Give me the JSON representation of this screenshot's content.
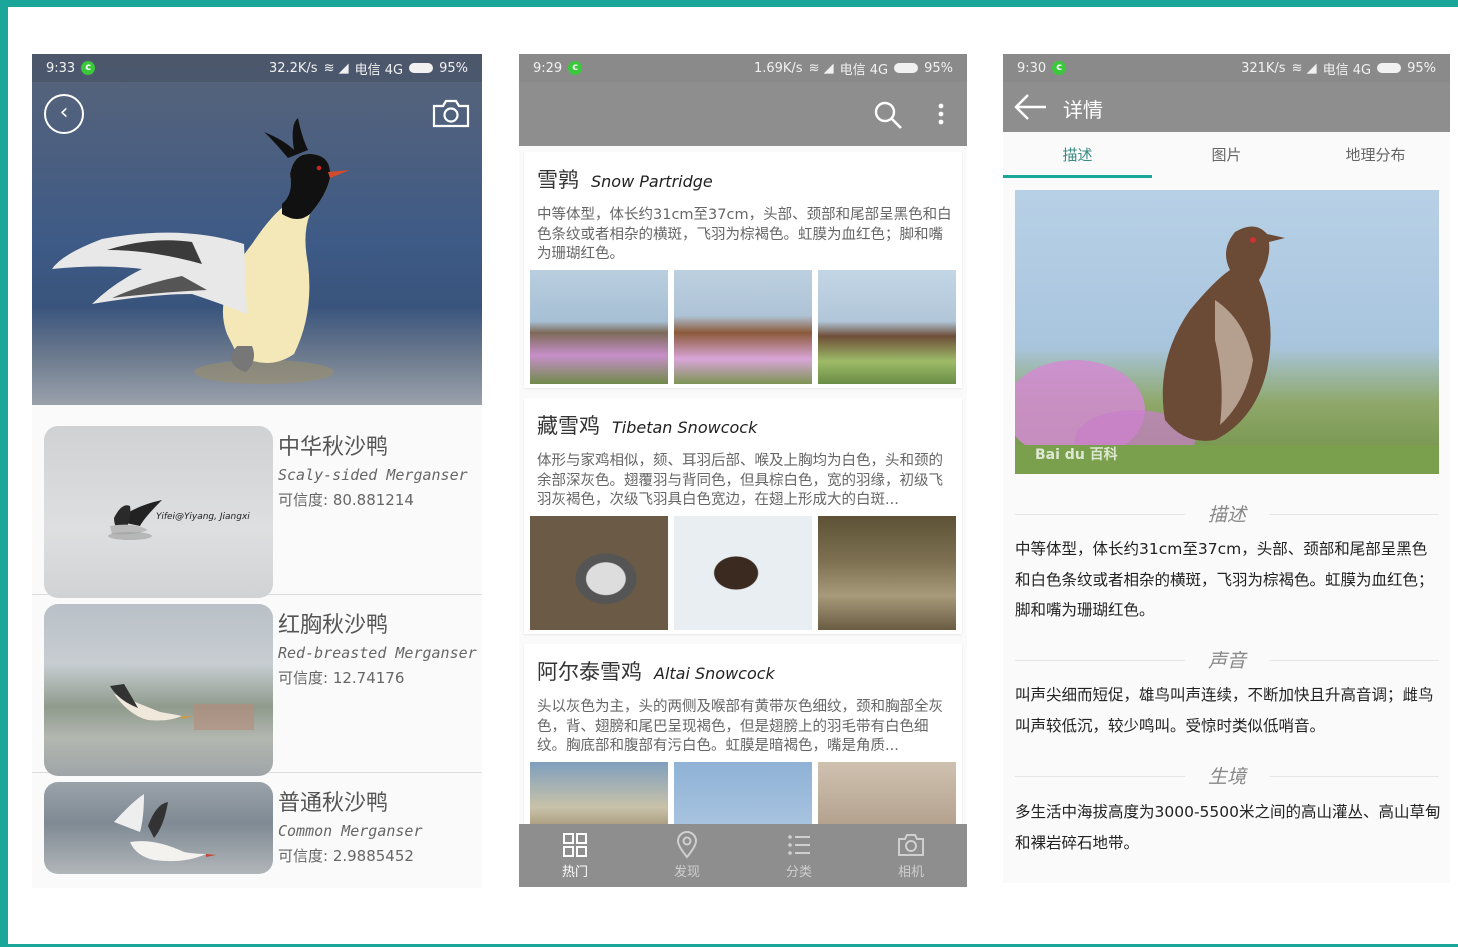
{
  "screens": {
    "identify": {
      "status": {
        "time": "9:33",
        "speed": "32.2K/s",
        "carrier": "电信 4G",
        "battery": "95%"
      },
      "photo_watermark": "Yifei@Yiyang, Jiangxi",
      "results": [
        {
          "cn": "中华秋沙鸭",
          "en": "Scaly-sided Merganser",
          "confidence": "可信度: 80.881214"
        },
        {
          "cn": "红胸秋沙鸭",
          "en": "Red-breasted Merganser",
          "confidence": "可信度: 12.74176"
        },
        {
          "cn": "普通秋沙鸭",
          "en": "Common Merganser",
          "confidence": "可信度: 2.9885452"
        }
      ]
    },
    "browse": {
      "status": {
        "time": "9:29",
        "speed": "1.69K/s",
        "carrier": "电信 4G",
        "battery": "95%"
      },
      "cards": [
        {
          "cn": "雪鹑",
          "en": "Snow Partridge",
          "desc": "中等体型，体长约31cm至37cm，头部、颈部和尾部呈黑色和白色条纹或者相杂的横斑，飞羽为棕褐色。虹膜为血红色；脚和嘴为珊瑚红色。"
        },
        {
          "cn": "藏雪鸡",
          "en": "Tibetan Snowcock",
          "desc": "体形与家鸡相似，颏、耳羽后部、喉及上胸均为白色，头和颈的余部深灰色。翅覆羽与背同色，但具棕白色，宽的羽缘，初级飞羽灰褐色，次级飞羽具白色宽边，在翅上形成大的白斑..."
        },
        {
          "cn": "阿尔泰雪鸡",
          "en": "Altai Snowcock",
          "desc": "头以灰色为主，头的两侧及喉部有黄带灰色细纹，颈和胸部全灰色，背、翅膀和尾巴呈现褐色，但是翅膀上的羽毛带有白色细纹。胸底部和腹部有污白色。虹膜是暗褐色，嘴是角质..."
        }
      ],
      "nav": [
        {
          "label": "热门",
          "icon": "grid-icon"
        },
        {
          "label": "发现",
          "icon": "location-pin-icon"
        },
        {
          "label": "分类",
          "icon": "list-icon"
        },
        {
          "label": "相机",
          "icon": "camera-icon"
        }
      ]
    },
    "detail": {
      "status": {
        "time": "9:30",
        "speed": "321K/s",
        "carrier": "电信 4G",
        "battery": "95%"
      },
      "title": "详情",
      "tabs": [
        "描述",
        "图片",
        "地理分布"
      ],
      "photo_watermark": "Bai du 百科",
      "sections": [
        {
          "heading": "描述",
          "text": "中等体型，体长约31cm至37cm，头部、颈部和尾部呈黑色和白色条纹或者相杂的横斑，飞羽为棕褐色。虹膜为血红色；脚和嘴为珊瑚红色。"
        },
        {
          "heading": "声音",
          "text": "叫声尖细而短促，雄鸟叫声连续，不断加快且升高音调；雌鸟叫声较低沉，较少鸣叫。受惊时类似低哨音。"
        },
        {
          "heading": "生境",
          "text": "多生活中海拔高度为3000-5500米之间的高山灌丛、高山草甸和裸岩碎石地带。"
        }
      ]
    }
  },
  "colors": {
    "accent": "#1aa79a",
    "appbar": "#8e8e8e"
  }
}
